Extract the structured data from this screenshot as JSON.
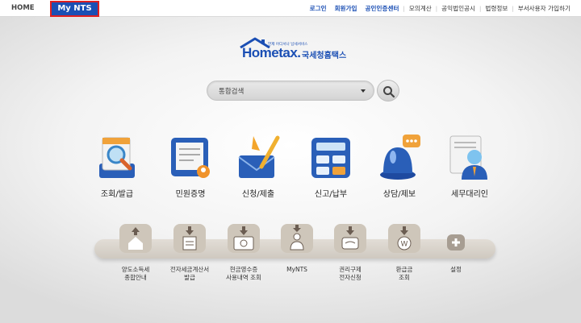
{
  "topbar": {
    "home": "HOME",
    "mynts": "My NTS",
    "links": [
      "로그인",
      "회원가입",
      "공인인증센터",
      "모의계산",
      "공익법인공시",
      "법령정보",
      "부서사용자 가입하기"
    ]
  },
  "logo": {
    "tagline": "언제 어디서나 납세서비스",
    "main": "Hometax.",
    "kr": "국세청홈택스"
  },
  "search": {
    "placeholder": "통합검색"
  },
  "main_menu": [
    {
      "label": "조회/발급",
      "icon": "magnifier-document-icon"
    },
    {
      "label": "민원증명",
      "icon": "certificate-document-icon"
    },
    {
      "label": "신청/제출",
      "icon": "envelope-pen-icon"
    },
    {
      "label": "신고/납부",
      "icon": "calculator-icon"
    },
    {
      "label": "상담/제보",
      "icon": "siren-chat-icon"
    },
    {
      "label": "세무대리인",
      "icon": "tax-agent-person-icon"
    }
  ],
  "sub_menu": [
    {
      "line1": "양도소득세",
      "line2": "종합안내",
      "icon": "house-upload-icon"
    },
    {
      "line1": "전자세금계산서",
      "line2": "발급",
      "icon": "invoice-download-icon"
    },
    {
      "line1": "현금영수증",
      "line2": "사용내역 조회",
      "icon": "cash-receipt-icon"
    },
    {
      "line1": "MyNTS",
      "line2": "",
      "icon": "person-nts-icon"
    },
    {
      "line1": "권리구제",
      "line2": "전자신청",
      "icon": "handshake-icon"
    },
    {
      "line1": "환급금",
      "line2": "조회",
      "icon": "won-coin-icon"
    },
    {
      "line1": "설정",
      "line2": "",
      "icon": "plus-icon"
    }
  ],
  "colors": {
    "brand": "#1b4fb4",
    "highlight_border": "#e02020"
  }
}
